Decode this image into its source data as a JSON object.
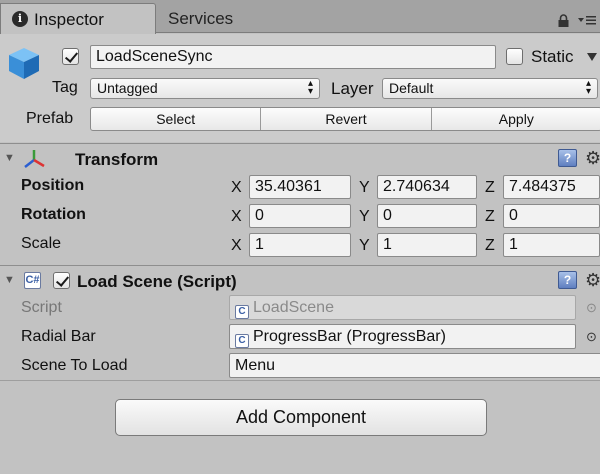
{
  "tabs": [
    {
      "label": "Inspector",
      "active": true,
      "icon": "info-icon"
    },
    {
      "label": "Services",
      "active": false
    }
  ],
  "header": {
    "active": true,
    "name": "LoadSceneSync",
    "static_label": "Static",
    "static_checked": false,
    "tag_label": "Tag",
    "tag_value": "Untagged",
    "layer_label": "Layer",
    "layer_value": "Default",
    "prefab_label": "Prefab",
    "prefab_buttons": [
      "Select",
      "Revert",
      "Apply"
    ]
  },
  "transform": {
    "title": "Transform",
    "rows": [
      {
        "label": "Position",
        "x": "35.40361",
        "y": "2.740634",
        "z": "7.484375"
      },
      {
        "label": "Rotation",
        "x": "0",
        "y": "0",
        "z": "0"
      },
      {
        "label": "Scale",
        "x": "1",
        "y": "1",
        "z": "1"
      }
    ],
    "axes": [
      "X",
      "Y",
      "Z"
    ]
  },
  "load_scene": {
    "title": "Load Scene (Script)",
    "enabled": true,
    "script_label": "Script",
    "script_value": "LoadScene",
    "radial_label": "Radial Bar",
    "radial_value": "ProgressBar (ProgressBar)",
    "scene_label": "Scene To Load",
    "scene_value": "Menu"
  },
  "footer": {
    "add_component": "Add Component"
  },
  "colors": {
    "background": "#c2c2c2",
    "help_icon": "#5f7fc0",
    "cube_icon": "#3a8fd8"
  }
}
